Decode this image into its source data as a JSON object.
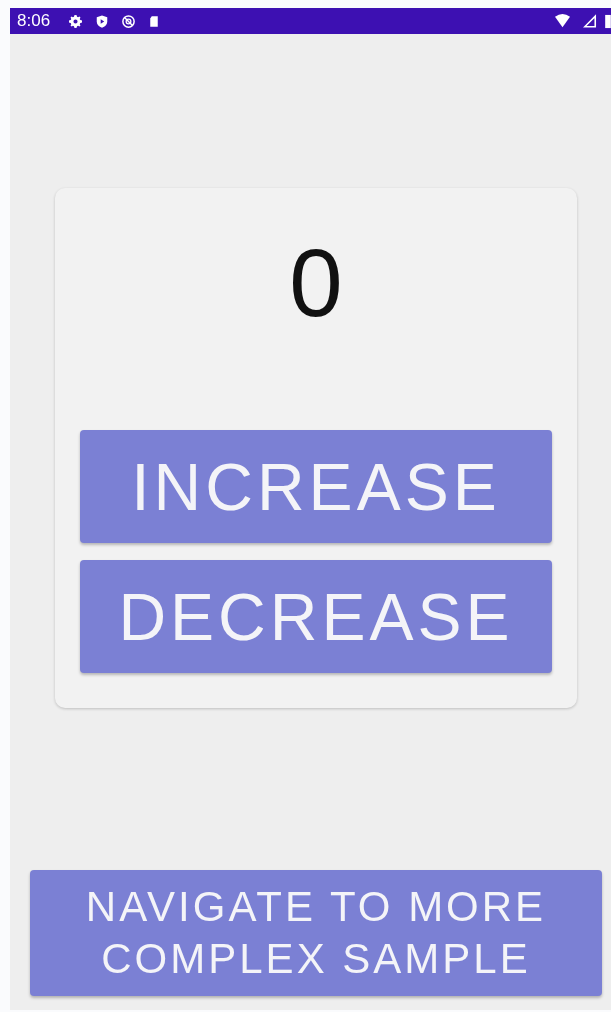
{
  "status_bar": {
    "time": "8:06"
  },
  "counter": {
    "value": "0"
  },
  "buttons": [
    {
      "label": "INCREASE"
    },
    {
      "label": "DECREASE"
    }
  ],
  "navigate_button": {
    "label": "NAVIGATE TO MORE COMPLEX SAMPLE"
  }
}
